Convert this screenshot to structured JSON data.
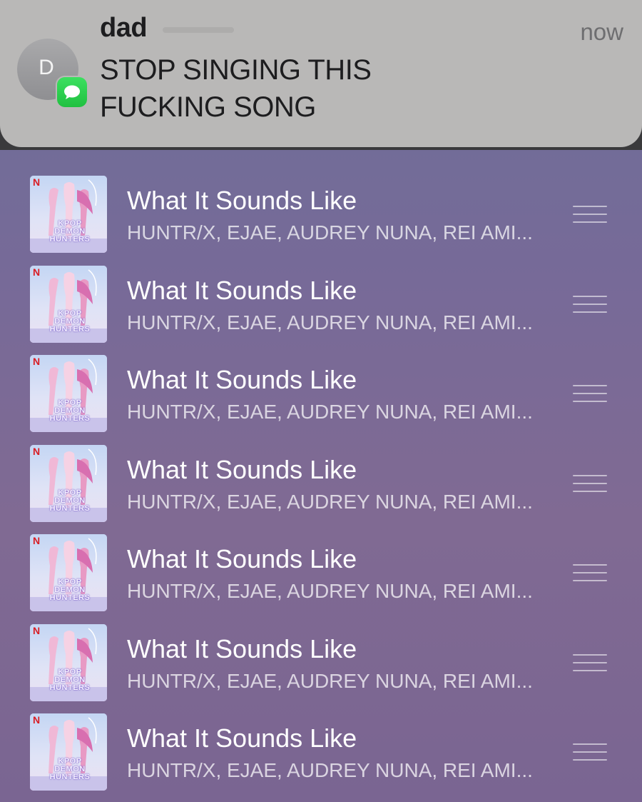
{
  "notification": {
    "sender": "dad",
    "avatar_initial": "D",
    "time": "now",
    "message": "STOP SINGING THIS FUCKING SONG",
    "app_icon": "messages-icon"
  },
  "queue": {
    "tracks": [
      {
        "title": "What It Sounds Like",
        "artist": "HUNTR/X, EJAE, AUDREY NUNA, REI AMI..."
      },
      {
        "title": "What It Sounds Like",
        "artist": "HUNTR/X, EJAE, AUDREY NUNA, REI AMI..."
      },
      {
        "title": "What It Sounds Like",
        "artist": "HUNTR/X, EJAE, AUDREY NUNA, REI AMI..."
      },
      {
        "title": "What It Sounds Like",
        "artist": "HUNTR/X, EJAE, AUDREY NUNA, REI AMI..."
      },
      {
        "title": "What It Sounds Like",
        "artist": "HUNTR/X, EJAE, AUDREY NUNA, REI AMI..."
      },
      {
        "title": "What It Sounds Like",
        "artist": "HUNTR/X, EJAE, AUDREY NUNA, REI AMI..."
      },
      {
        "title": "What It Sounds Like",
        "artist": "HUNTR/X, EJAE, AUDREY NUNA, REI AMI..."
      }
    ],
    "album_art_text": {
      "brand": "N",
      "line1": "KPOP",
      "line2": "DEMON",
      "line3": "HUNTERS"
    },
    "reorder_icon": "drag-handle-icon"
  },
  "colors": {
    "notification_bg": "#b9b8b7",
    "messages_green": "#2fd153",
    "background_top": "#6d6f98",
    "background_bottom": "#7a6592"
  }
}
